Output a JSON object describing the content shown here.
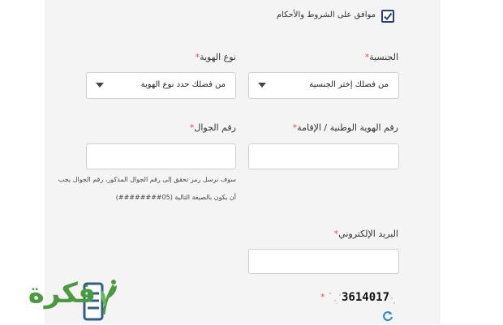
{
  "terms": {
    "label": "موافق على الشروط والأحكام",
    "checked": true
  },
  "nationality": {
    "label": "الجنسية",
    "required_mark": "*",
    "selected": "من فضلك إختر الجنسية"
  },
  "id_type": {
    "label": "نوع الهوية",
    "required_mark": "*",
    "selected": "من فضلك حدد نوع الهوية"
  },
  "national_id": {
    "label": "رقم الهوية الوطنية / الإقامة",
    "required_mark": "*",
    "value": ""
  },
  "mobile": {
    "label": "رقم الجوال",
    "required_mark": "*",
    "value": "",
    "hint_line1": "سوف نرسل رمز تحقق إلى رقم الجوال المذكور، رقم الجوال يجب",
    "hint_line2": "أن يكون بالصيغة التالية  (05########)"
  },
  "email": {
    "label": "البريد الإلكتروني",
    "required_mark": "*",
    "value": ""
  },
  "captcha": {
    "required_mark": "*",
    "code": "3614017",
    "refresh_icon": "refresh-icon"
  },
  "watermark": {
    "text": "فكرة",
    "color": "#4a9a3e"
  },
  "colors": {
    "panel": "#f4f4f4",
    "required": "#d9534f",
    "checkbox_border": "#2c3e7a"
  }
}
